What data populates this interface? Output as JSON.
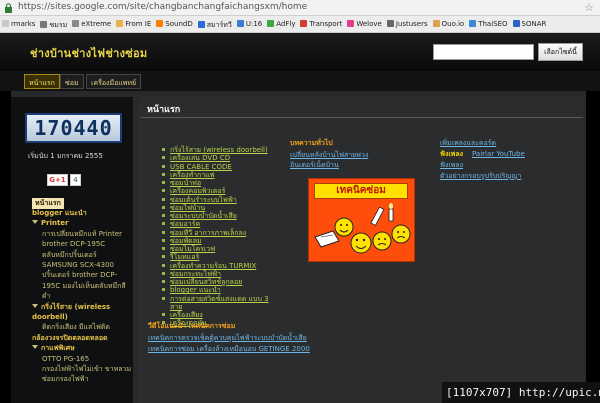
{
  "browser": {
    "url": "https://sites.google.com/site/changbanchangfaichangsxm/home",
    "bookmarks": [
      {
        "label": "rmarks",
        "color": "#c8c8c8"
      },
      {
        "label": "ชมรม",
        "color": "#777777"
      },
      {
        "label": "eXtreme",
        "color": "#888888"
      },
      {
        "label": "From IE",
        "color": "#e8b34a"
      },
      {
        "label": "SoundD",
        "color": "#ff7a00"
      },
      {
        "label": "สมาร์ทวี",
        "color": "#2b6bd6"
      },
      {
        "label": "U:16",
        "color": "#3a7bd5"
      },
      {
        "label": "AdFly",
        "color": "#3da643"
      },
      {
        "label": "Transport",
        "color": "#d43c2c"
      },
      {
        "label": "Welove",
        "color": "#e33e8a"
      },
      {
        "label": "Justusers",
        "color": "#666666"
      },
      {
        "label": "Ouo.io",
        "color": "#e0a050"
      },
      {
        "label": "ThaiSEO",
        "color": "#3a8ad6"
      },
      {
        "label": "SONAR",
        "color": "#2a64c4"
      }
    ]
  },
  "header": {
    "site_title": "ช่างบ้านช่างไฟช่างซ่อม",
    "search_placeholder": "",
    "search_button": "เลือกไซต์นี้"
  },
  "nav": {
    "tabs": [
      {
        "label": "หน้าแรก",
        "selected": true
      },
      {
        "label": "ซ่อม",
        "selected": false
      },
      {
        "label": "เครื่องมือแพทย์",
        "selected": false
      }
    ]
  },
  "sidebar": {
    "counter": "170440",
    "since": "เริ่มนับ 1 มกราคม 2555",
    "gplus_label": "G+1",
    "gplus_count": "4",
    "items": [
      {
        "label": "หน้าแรก",
        "level": 1,
        "selected": true
      },
      {
        "label": "blogger แนะนำ",
        "level": 1
      },
      {
        "label": "Printer",
        "level": 1,
        "expanded": true
      },
      {
        "label": "การเปลี่ยนหมึกแท้ Printer",
        "level": 2
      },
      {
        "label": "brother DCP-195C",
        "level": 2
      },
      {
        "label": "ตลับหมึกปริ้นเตอร์",
        "level": 2
      },
      {
        "label": "SAMSUNG SCX-4300",
        "level": 2
      },
      {
        "label": "ปริ้นเตอร์ brother DCP-",
        "level": 2
      },
      {
        "label": "195C มองไม่เห็นตลับหมึกสี",
        "level": 2
      },
      {
        "label": "ดำ",
        "level": 2
      },
      {
        "label": "กริ่งไร้สาย (wireless",
        "level": 1,
        "expanded": true
      },
      {
        "label": "doorbell)",
        "level": 1
      },
      {
        "label": "ติดกริ่งเสียง มีแสไฟติด",
        "level": 2
      },
      {
        "label": "กล้องวงจรปิดตลอดหลอด",
        "level": 1
      },
      {
        "label": "กาแฟพิเศษ",
        "level": 1,
        "expanded": true
      },
      {
        "label": "OTTO PG-165",
        "level": 2
      },
      {
        "label": "กรองไฟฟ้าไฟไม่เข้า ขาหลวม",
        "level": 2
      },
      {
        "label": "ซ่อมกรองไฟฟ้า",
        "level": 2
      }
    ]
  },
  "main": {
    "page_title": "หน้าแรก",
    "col1_links": [
      "กริ่งไร้สาย (wireless doorbell)",
      "เครื่องเล่น DVD CD",
      "USB CABLE CODE",
      "เครื่องทำกาแฟ",
      "ซ่อมน้ำท่อ",
      "เครื่องคอมพิวเตอร์",
      "ซ่อมเต้นรำระบบไฟฟ้า",
      "ซ่อมไฟบ้าน",
      "ซ่อมระบบบำบัดน้ำเสีย",
      "ซ่อมอาร์ค",
      "ซ่อมทีวี อาการภาพเล็กลง",
      "ซ่อมพัดลม",
      "ซ่อมไมโครเวฟ",
      "รีโมทแอร์",
      "เครื่องทำความร้อน TURMIX",
      "ซ่อมกระทะไฟฟ้า",
      "ซ่อมเปลี่ยนสวิทช์ลูกลอย",
      "blogger แนะนำ",
      "การต่อสายสวิตช์แสงแดด แบบ 3",
      "สาย",
      "เครื่องเสียง",
      "เครื่องดูดฝุ่น"
    ],
    "col2_heading": "บทความทั่วไป",
    "col2_links": [
      "เปลี่ยนหลังบ้านไฟสายพ่วง",
      "อินเตอร์เน็ตบ้าน"
    ],
    "cartoon_text": "เทคนิคซ่อม",
    "col3_links": [
      "เพิ่มเพลงและคอร์ด"
    ],
    "col3_fang_label": "ฟังเพลง",
    "col3_fang_link": "Pairlar YouTube",
    "col3_links2": [
      "ฟังเพลง",
      "ตัวอย่างกรอบรูปรับปริญญา"
    ],
    "video_heading": "วีดีโอแนะนำ เทคนิคการซ่อม",
    "video_links": [
      "เทคนิคการตรวจเช็คตู้ควบคุมไฟฟ้าระบบบำบัดน้ำเสีย",
      "เทคนิคการซ่อม เครื่องล้างเหมือนอบ GETINGE 2000"
    ]
  },
  "watermark": "[1107x707] http://upic.me/"
}
